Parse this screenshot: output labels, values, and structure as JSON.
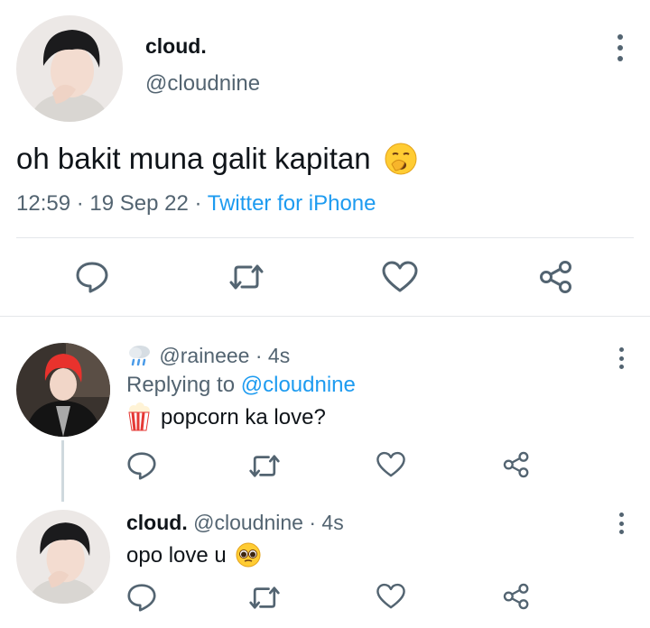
{
  "main_tweet": {
    "display_name": "cloud.",
    "handle": "@cloudnine",
    "text": "oh bakit muna galit kapitan",
    "text_emoji": "yawning-face",
    "time": "12:59",
    "sep1": "·",
    "date": "19 Sep 22",
    "sep2": "·",
    "source": "Twitter for iPhone"
  },
  "reply1": {
    "handle": "@raineee",
    "separator": "·",
    "time": "4s",
    "name_emoji": "cloud-with-rain",
    "replying_prefix": "Replying to",
    "replying_to": "@cloudnine",
    "text": "popcorn ka love?",
    "text_emoji": "popcorn"
  },
  "reply2": {
    "display_name": "cloud.",
    "handle": "@cloudnine",
    "separator": "·",
    "time": "4s",
    "text": "opo love u",
    "text_emoji": "pleading-face"
  },
  "colors": {
    "link": "#1d9bf0",
    "secondary_text": "#536471",
    "divider": "#e4e7ea",
    "thread_line": "#cfd9de"
  }
}
